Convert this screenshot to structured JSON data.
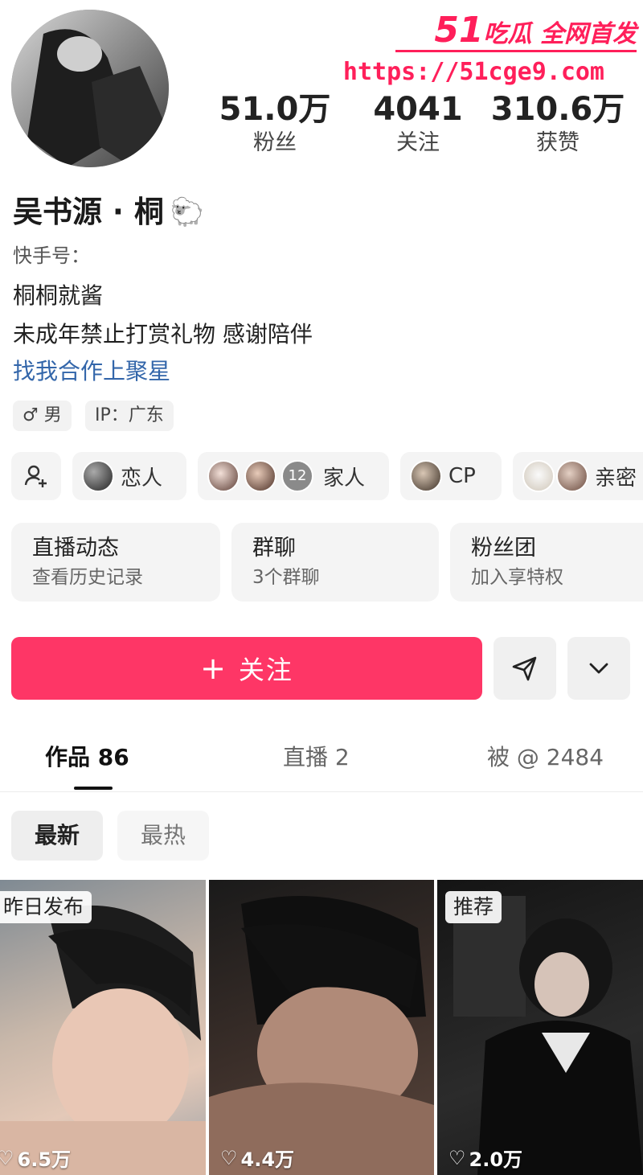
{
  "watermark": {
    "brand_num": "51",
    "brand_text": "吃瓜 全网首发",
    "url": "https://51cge9.com"
  },
  "profile": {
    "name": "吴书源 · 桐",
    "name_emoji": "🐑",
    "kuaishou_label": "快手号：",
    "bio_lines": [
      "桐桐就酱",
      "未成年禁止打赏礼物 感谢陪伴"
    ],
    "bio_link": "找我合作上聚星",
    "gender_tag": "男",
    "gender_symbol": "♂",
    "ip_tag": "IP：广东"
  },
  "stats": [
    {
      "value": "51.0万",
      "label": "粉丝"
    },
    {
      "value": "4041",
      "label": "关注"
    },
    {
      "value": "310.6万",
      "label": "获赞"
    }
  ],
  "relations": {
    "lover": "恋人",
    "family": "家人",
    "family_count": "12",
    "cp": "CP",
    "close": "亲密"
  },
  "cards": [
    {
      "title": "直播动态",
      "subtitle": "查看历史记录"
    },
    {
      "title": "群聊",
      "subtitle": "3个群聊"
    },
    {
      "title": "粉丝团",
      "subtitle": "加入享特权"
    }
  ],
  "actions": {
    "follow_plus": "+",
    "follow_label": "关注"
  },
  "tabs": [
    {
      "label": "作品 86"
    },
    {
      "label": "直播 2"
    },
    {
      "label": "被 @ 2484"
    }
  ],
  "sort": {
    "newest": "最新",
    "hottest": "最热"
  },
  "videos": [
    {
      "tag": "昨日发布",
      "likes": "6.5万"
    },
    {
      "tag": "",
      "likes": "4.4万"
    },
    {
      "tag": "推荐",
      "likes": "2.0万"
    }
  ],
  "colors": {
    "accent": "#fe3666",
    "link": "#3366aa",
    "watermark": "#ff1f5a"
  }
}
